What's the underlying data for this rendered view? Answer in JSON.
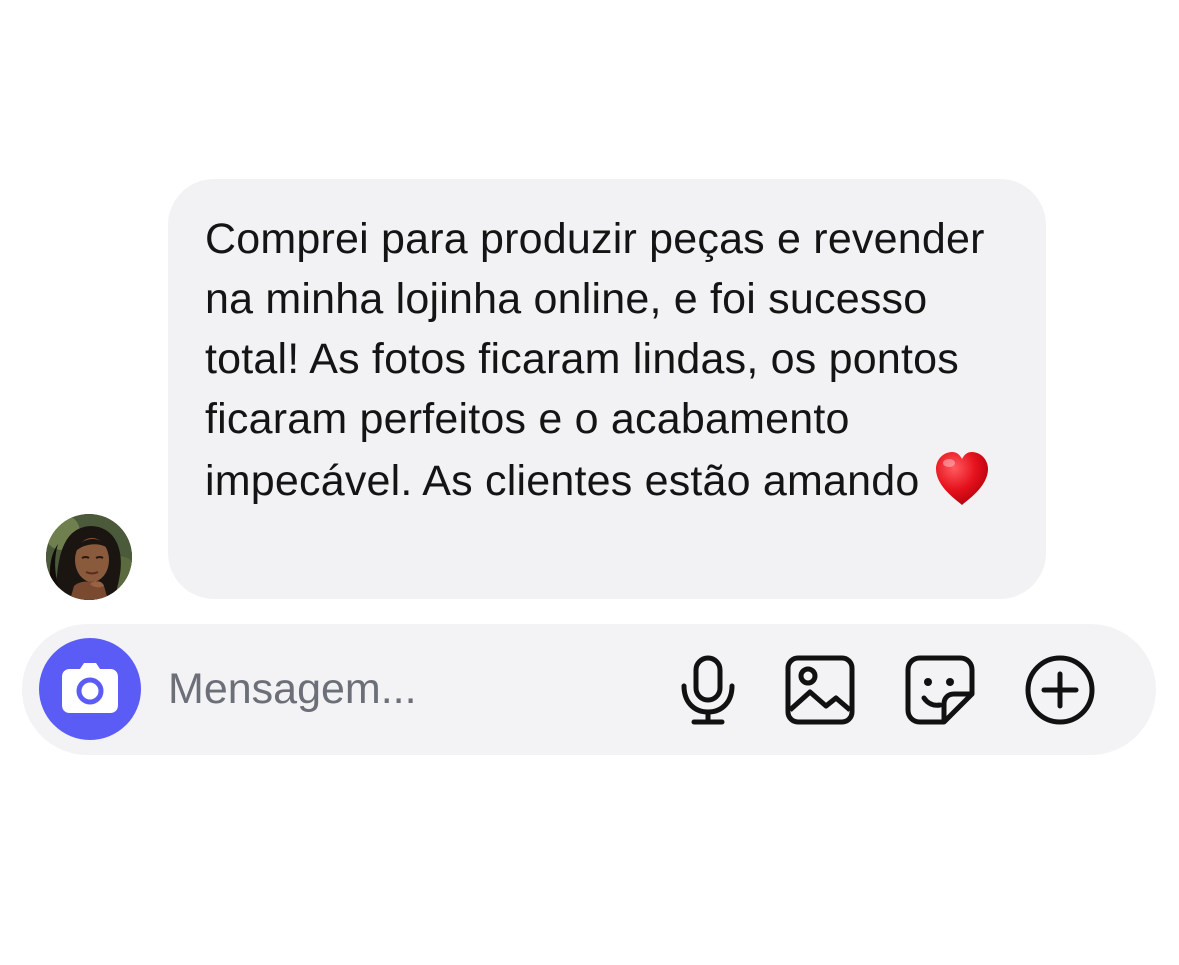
{
  "message": {
    "text": "Comprei para produzir peças e revender na minha lojinha online, e foi sucesso total! As fotos ficaram lindas, os pontos ficaram perfeitos e o acabamento impecável. As clientes estão amando",
    "emoji": "heart-emoji"
  },
  "composer": {
    "placeholder": "Mensagem...",
    "value": "",
    "icons": [
      "camera-icon",
      "microphone-icon",
      "image-icon",
      "sticker-icon",
      "plus-circle-icon"
    ]
  },
  "colors": {
    "bubble_background": "#f2f2f4",
    "composer_background": "#f3f3f5",
    "camera_button": "#5b5cf6",
    "text": "#141414",
    "placeholder": "#6c6f78",
    "heart": "#e5121d"
  }
}
